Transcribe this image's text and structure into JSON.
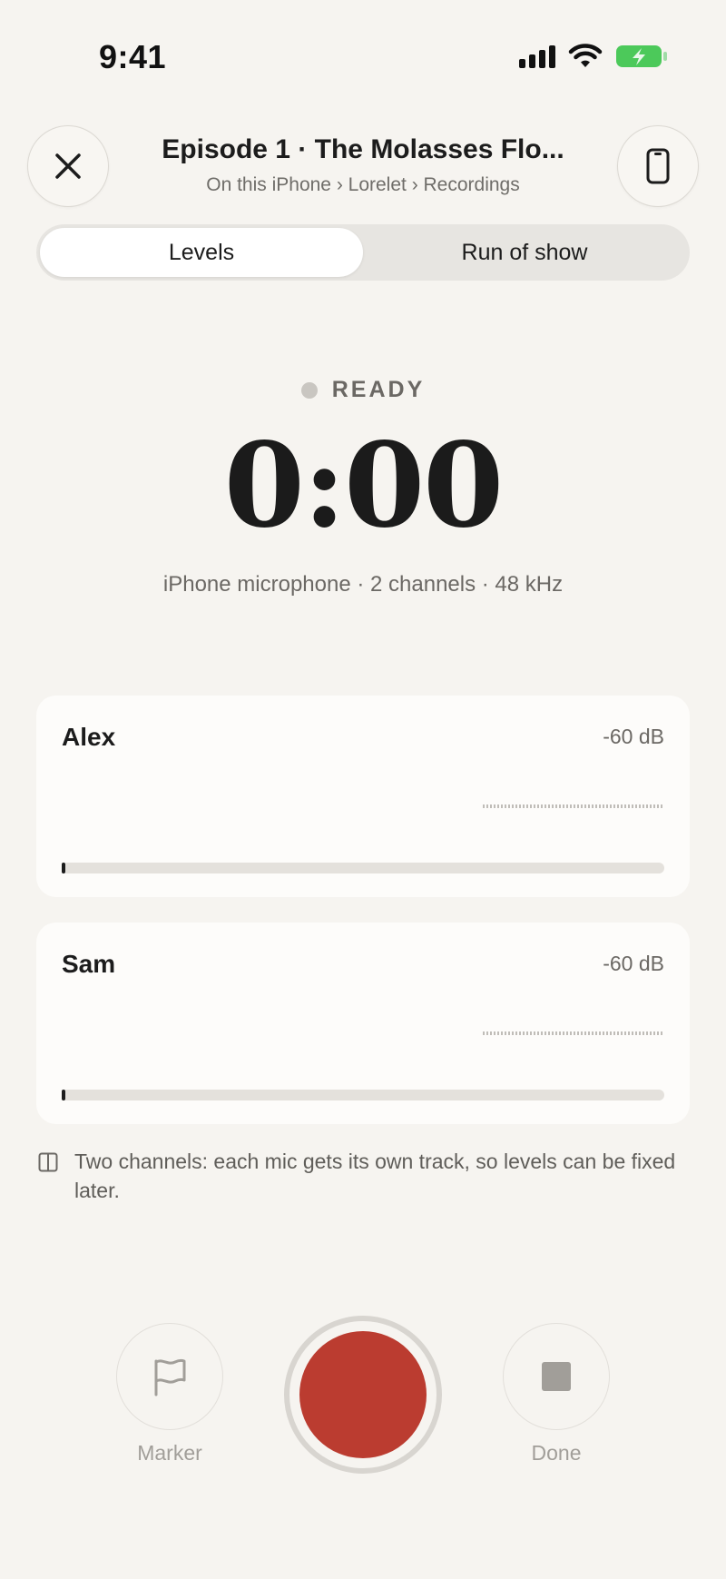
{
  "status_bar": {
    "time": "9:41"
  },
  "header": {
    "episode_title": "Episode 1 · The Molasses Flo...",
    "breadcrumb": "On this iPhone › Lorelet › Recordings"
  },
  "tabs": [
    {
      "label": "Levels",
      "active": true
    },
    {
      "label": "Run of show",
      "active": false
    }
  ],
  "recorder": {
    "status": "READY",
    "timer": "0:00",
    "input_info": "iPhone microphone · 2 channels · 48 kHz"
  },
  "channels": [
    {
      "name": "Alex",
      "level_db": "-60 dB",
      "level_fraction": 0.0
    },
    {
      "name": "Sam",
      "level_db": "-60 dB",
      "level_fraction": 0.0
    }
  ],
  "hint": {
    "text": "Two channels: each mic gets its own track, so levels can be fixed later."
  },
  "controls": {
    "marker_label": "Marker",
    "done_label": "Done"
  },
  "colors": {
    "record": "#bb3c30",
    "background": "#f6f4f0",
    "battery": "#4cc95a"
  },
  "icons": {
    "close": "close-icon",
    "device": "iphone-icon",
    "marker": "flag-icon",
    "done": "stop-icon",
    "hint": "split-columns-icon"
  }
}
